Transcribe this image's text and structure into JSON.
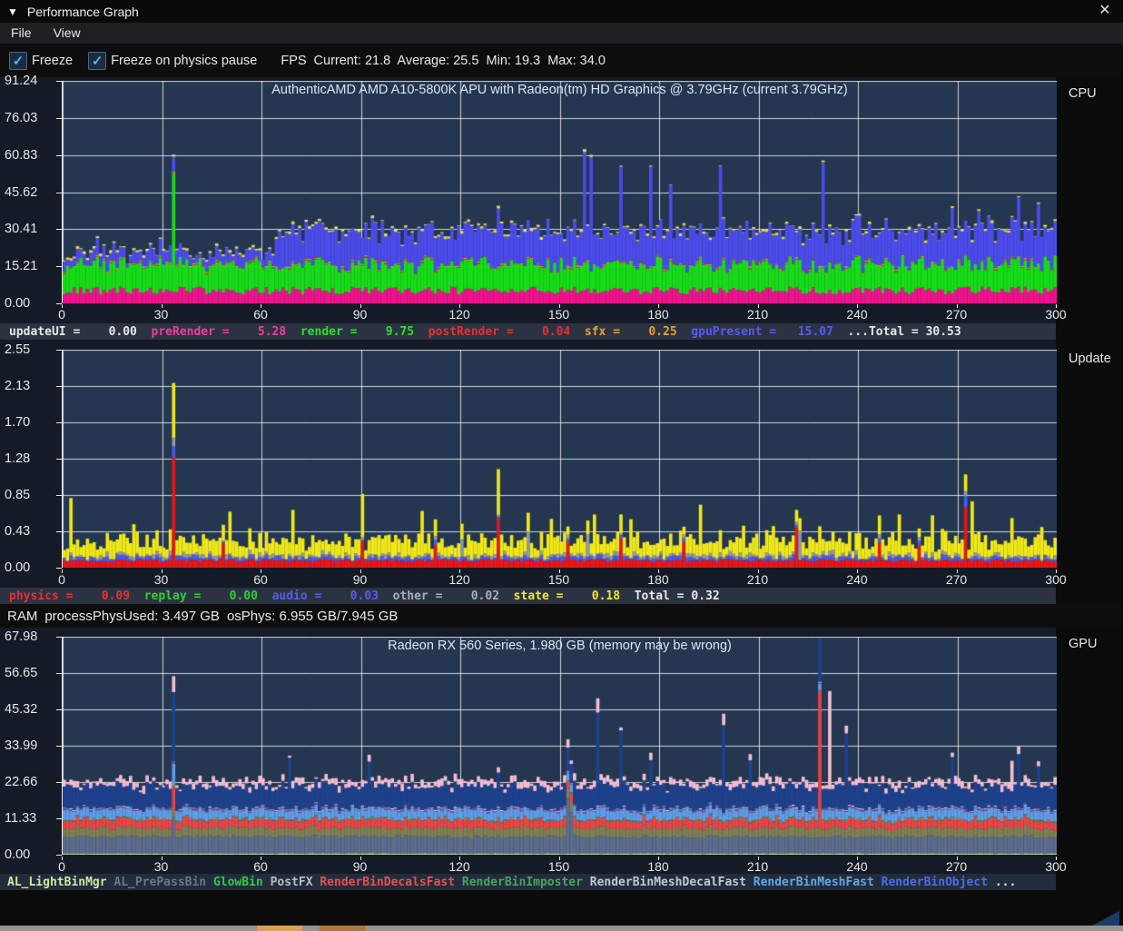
{
  "window": {
    "title": "Performance Graph",
    "icon": "▼",
    "close_icon": "✕"
  },
  "menu": {
    "items": [
      {
        "label": "File"
      },
      {
        "label": "View"
      }
    ]
  },
  "toolbar": {
    "check_glyph": "✓",
    "freeze": {
      "label": "Freeze",
      "checked": true
    },
    "freeze_physics": {
      "label": "Freeze on physics pause",
      "checked": true
    },
    "fps": {
      "label": "FPS",
      "stats": "Current: 21.8  Average: 25.5  Min: 19.3  Max: 34.0"
    }
  },
  "ram_bar": {
    "label": "RAM",
    "process": "processPhysUsed: 3.497 GB",
    "os": "osPhys: 6.955 GB/7.945 GB"
  },
  "chart_data": [
    {
      "id": "cpu",
      "type": "stacked-bar",
      "right_label": "CPU",
      "seed": 7,
      "title": "AuthenticAMD AMD A10-5800K APU with Radeon(tm) HD Graphics   @ 3.79GHz (current 3.79GHz)",
      "ymax": 91.24,
      "y_ticks": [
        "91.24",
        "76.03",
        "60.83",
        "45.62",
        "30.41",
        "15.21",
        "0.00"
      ],
      "x_range": [
        0,
        300
      ],
      "x_ticks": [
        0,
        30,
        60,
        90,
        120,
        150,
        180,
        210,
        240,
        270,
        300
      ],
      "n_points": 300,
      "plot_bg": "#243650",
      "grid": true,
      "series": [
        {
          "name": "preRender",
          "color": "#f0128c",
          "base": 5.3,
          "var": 1.6
        },
        {
          "name": "render",
          "color": "#16dd16",
          "base": 10.5,
          "var": 2.6
        },
        {
          "name": "postRender",
          "color": "#e03030",
          "base": 0.18,
          "var": 0.35
        },
        {
          "name": "sfx",
          "color": "#e09020",
          "base": 0.28,
          "var": 0.4
        },
        {
          "name": "gpuPresent",
          "color": "#4b4beb",
          "base": 13.2,
          "var": 3.2,
          "profile": [
            {
              "from": 0,
              "to": 63,
              "base": 4.2,
              "var": 2.8
            },
            {
              "from": 64,
              "to": 300,
              "base": 13.2,
              "var": 3.2
            }
          ]
        },
        {
          "name": "yellowCap",
          "color": "#f0e030",
          "base": 0.45,
          "var": 0.55
        },
        {
          "name": "updateUI_dots",
          "color": "#f0f0f0",
          "base": 0.08,
          "var": 0.3
        }
      ],
      "spikes": [
        {
          "x": 33,
          "series": "render",
          "add": 38
        },
        {
          "x": 131,
          "series": "gpuPresent",
          "add": 12
        },
        {
          "x": 157,
          "series": "gpuPresent",
          "add": 30
        },
        {
          "x": 159,
          "series": "gpuPresent",
          "add": 33
        },
        {
          "x": 168,
          "series": "gpuPresent",
          "add": 28
        },
        {
          "x": 177,
          "series": "gpuPresent",
          "add": 26
        },
        {
          "x": 183,
          "series": "gpuPresent",
          "add": 18
        },
        {
          "x": 198,
          "series": "gpuPresent",
          "add": 28
        },
        {
          "x": 229,
          "series": "gpuPresent",
          "add": 31
        },
        {
          "x": 268,
          "series": "gpuPresent",
          "add": 12
        },
        {
          "x": 276,
          "series": "gpuPresent",
          "add": 10
        },
        {
          "x": 288,
          "series": "gpuPresent",
          "add": 11
        },
        {
          "x": 294,
          "series": "gpuPresent",
          "add": 9
        }
      ],
      "legend": {
        "bg": "#2b3342",
        "items": [
          {
            "label": "updateUI",
            "value": "0.00",
            "color": "#e8e8e8",
            "pad": true
          },
          {
            "label": "preRender",
            "value": "5.28",
            "color": "#f03ca0",
            "pad": true
          },
          {
            "label": "render",
            "value": "9.75",
            "color": "#30e030",
            "pad": true
          },
          {
            "label": "postRender",
            "value": "0.04",
            "color": "#e83030",
            "pad": true
          },
          {
            "label": "sfx",
            "value": "0.25",
            "color": "#e8a030",
            "pad": true
          },
          {
            "label": "gpuPresent",
            "value": "15.07",
            "color": "#5858f0",
            "pad": true
          },
          {
            "label": "...Total",
            "value": "30.53",
            "color": "#e8e8e8",
            "pad": false
          }
        ]
      }
    },
    {
      "id": "update",
      "type": "stacked-bar",
      "right_label": "Update",
      "seed": 13,
      "title": "",
      "ymax": 2.55,
      "y_ticks": [
        "2.55",
        "2.13",
        "1.70",
        "1.28",
        "0.85",
        "0.43",
        "0.00"
      ],
      "x_range": [
        0,
        300
      ],
      "x_ticks": [
        0,
        30,
        60,
        90,
        120,
        150,
        180,
        210,
        240,
        270,
        300
      ],
      "n_points": 300,
      "plot_bg": "#243650",
      "grid": true,
      "series": [
        {
          "name": "physics",
          "color": "#e81616",
          "base": 0.085,
          "var": 0.02
        },
        {
          "name": "audio",
          "color": "#4b5ae8",
          "base": 0.035,
          "var": 0.025
        },
        {
          "name": "other",
          "color": "#9098a8",
          "base": 0.028,
          "var": 0.03
        },
        {
          "name": "state",
          "color": "#f0e818",
          "base": 0.17,
          "var": 0.09
        }
      ],
      "spikes": [
        {
          "x": 33,
          "series": "physics",
          "add": 1.2
        },
        {
          "x": 33,
          "series": "audio",
          "add": 0.08
        },
        {
          "x": 33,
          "series": "other",
          "add": 0.1
        },
        {
          "x": 33,
          "series": "state",
          "add": 0.52
        },
        {
          "x": 131,
          "series": "physics",
          "add": 0.48
        },
        {
          "x": 131,
          "series": "state",
          "add": 0.3
        },
        {
          "x": 221,
          "series": "physics",
          "add": 0.38
        },
        {
          "x": 272,
          "series": "physics",
          "add": 0.62
        },
        {
          "x": 272,
          "series": "audio",
          "add": 0.1
        },
        {
          "x": 48,
          "series": "physics",
          "add": 0.2
        },
        {
          "x": 90,
          "series": "physics",
          "add": 0.22
        },
        {
          "x": 112,
          "series": "physics",
          "add": 0.18
        },
        {
          "x": 152,
          "series": "physics",
          "add": 0.22
        },
        {
          "x": 168,
          "series": "physics",
          "add": 0.25
        },
        {
          "x": 187,
          "series": "physics",
          "add": 0.2
        },
        {
          "x": 246,
          "series": "physics",
          "add": 0.22
        },
        {
          "x": 258,
          "series": "physics",
          "add": 0.18
        },
        {
          "x": 120,
          "series": "other",
          "add": 0.15
        },
        {
          "x": 140,
          "series": "other",
          "add": 0.28
        },
        {
          "x": 158,
          "series": "other",
          "add": 0.22
        },
        {
          "x": 222,
          "series": "other",
          "add": 0.33
        },
        {
          "x": 2,
          "series": "state",
          "add": 0.42
        },
        {
          "x": 21,
          "series": "state",
          "add": 0.28
        },
        {
          "x": 50,
          "series": "state",
          "add": 0.25
        },
        {
          "x": 69,
          "series": "state",
          "add": 0.32
        },
        {
          "x": 90,
          "series": "state",
          "add": 0.25
        },
        {
          "x": 108,
          "series": "state",
          "add": 0.3
        },
        {
          "x": 147,
          "series": "state",
          "add": 0.33
        },
        {
          "x": 160,
          "series": "state",
          "add": 0.28
        },
        {
          "x": 171,
          "series": "state",
          "add": 0.25
        },
        {
          "x": 192,
          "series": "state",
          "add": 0.38
        },
        {
          "x": 205,
          "series": "state",
          "add": 0.22
        },
        {
          "x": 214,
          "series": "state",
          "add": 0.25
        },
        {
          "x": 228,
          "series": "state",
          "add": 0.2
        },
        {
          "x": 240,
          "series": "state",
          "add": 0.22
        },
        {
          "x": 252,
          "series": "state",
          "add": 0.25
        },
        {
          "x": 262,
          "series": "state",
          "add": 0.2
        },
        {
          "x": 274,
          "series": "state",
          "add": 0.42
        },
        {
          "x": 286,
          "series": "state",
          "add": 0.3
        },
        {
          "x": 295,
          "series": "state",
          "add": 0.22
        }
      ],
      "legend": {
        "bg": "#2b3342",
        "items": [
          {
            "label": "physics",
            "value": "0.09",
            "color": "#e83030",
            "pad": true
          },
          {
            "label": "replay",
            "value": "0.00",
            "color": "#30d030",
            "pad": true
          },
          {
            "label": "audio",
            "value": "0.03",
            "color": "#5560e8",
            "pad": true
          },
          {
            "label": "other",
            "value": "0.02",
            "color": "#a8aeb8",
            "pad": true
          },
          {
            "label": "state",
            "value": "0.18",
            "color": "#f0e830",
            "pad": true
          },
          {
            "label": "Total",
            "value": "0.32",
            "color": "#e8e8e8",
            "pad": false
          }
        ]
      }
    },
    {
      "id": "gpu",
      "type": "stacked-bar",
      "right_label": "GPU",
      "seed": 21,
      "title": "Radeon RX 560 Series, 1.980 GB (memory may be wrong)",
      "ymax": 67.98,
      "y_ticks": [
        "67.98",
        "56.65",
        "45.32",
        "33.99",
        "22.66",
        "11.33",
        "0.00"
      ],
      "x_range": [
        0,
        300
      ],
      "x_ticks": [
        0,
        30,
        60,
        90,
        120,
        150,
        180,
        210,
        240,
        270,
        300
      ],
      "n_points": 300,
      "plot_bg": "#243650",
      "grid": true,
      "series": [
        {
          "name": "AL_LightBinMgr",
          "color": "#c6e296",
          "base": 0.35,
          "var": 0.12
        },
        {
          "name": "AL_PrePassBin",
          "color": "#5c6c8a",
          "base": 5.3,
          "var": 0.5
        },
        {
          "name": "PostFX",
          "color": "#7e7e52",
          "base": 2.7,
          "var": 0.5
        },
        {
          "name": "RenderBinDecalsFast",
          "color": "#e84545",
          "base": 2.6,
          "var": 0.6
        },
        {
          "name": "RenderBinImposter",
          "color": "#2f9e50",
          "base": 0.3,
          "var": 0.2
        },
        {
          "name": "RenderBinMeshFast",
          "color": "#5e9ce8",
          "base": 2.7,
          "var": 0.5
        },
        {
          "name": "purpleSliver",
          "color": "#8a3c92",
          "base": 0.35,
          "var": 0.25
        },
        {
          "name": "whiteSliver",
          "color": "#e8e8f0",
          "base": 0.22,
          "var": 0.12
        },
        {
          "name": "RenderBinObject",
          "color": "#1d418c",
          "base": 6.8,
          "var": 1.3
        },
        {
          "name": "RenderBinMeshDecalFast",
          "color": "#f5bdd2",
          "base": 1.5,
          "var": 1.1
        }
      ],
      "spikes": [
        {
          "x": 33,
          "series": "AL_PrePassBin",
          "add": 6
        },
        {
          "x": 33,
          "series": "RenderBinDecalsFast",
          "add": 5
        },
        {
          "x": 33,
          "series": "RenderBinMeshFast",
          "add": 4
        },
        {
          "x": 33,
          "series": "RenderBinObject",
          "add": 14
        },
        {
          "x": 33,
          "series": "RenderBinMeshDecalFast",
          "add": 4
        },
        {
          "x": 152,
          "series": "AL_PrePassBin",
          "add": 12
        },
        {
          "x": 153,
          "series": "AL_PrePassBin",
          "add": 8
        },
        {
          "x": 68,
          "series": "RenderBinObject",
          "add": 9
        },
        {
          "x": 92,
          "series": "RenderBinObject",
          "add": 8
        },
        {
          "x": 131,
          "series": "RenderBinObject",
          "add": 5
        },
        {
          "x": 161,
          "series": "RenderBinObject",
          "add": 21
        },
        {
          "x": 161,
          "series": "RenderBinMeshDecalFast",
          "add": 3
        },
        {
          "x": 168,
          "series": "RenderBinObject",
          "add": 19
        },
        {
          "x": 177,
          "series": "RenderBinObject",
          "add": 9
        },
        {
          "x": 199,
          "series": "RenderBinObject",
          "add": 20
        },
        {
          "x": 199,
          "series": "RenderBinMeshDecalFast",
          "add": 3
        },
        {
          "x": 207,
          "series": "RenderBinObject",
          "add": 8
        },
        {
          "x": 228,
          "series": "RenderBinDecalsFast",
          "add": 40
        },
        {
          "x": 228,
          "series": "RenderBinObject",
          "add": 6
        },
        {
          "x": 228,
          "series": "RenderBinMeshDecalFast",
          "add": 6
        },
        {
          "x": 231,
          "series": "RenderBinMeshDecalFast",
          "add": 30
        },
        {
          "x": 236,
          "series": "RenderBinObject",
          "add": 17
        },
        {
          "x": 268,
          "series": "RenderBinObject",
          "add": 7
        },
        {
          "x": 286,
          "series": "RenderBinMeshDecalFast",
          "add": 8
        },
        {
          "x": 288,
          "series": "RenderBinObject",
          "add": 10
        },
        {
          "x": 294,
          "series": "RenderBinObject",
          "add": 7
        }
      ],
      "legend": {
        "bg": "#222c3c",
        "items": [
          {
            "label": "AL_LightBinMgr",
            "color": "#d4e69e"
          },
          {
            "label": "AL_PrePassBin",
            "color": "#6b7688"
          },
          {
            "label": "GlowBin",
            "color": "#2ecc40"
          },
          {
            "label": "PostFX",
            "color": "#b8bcc4"
          },
          {
            "label": "RenderBinDecalsFast",
            "color": "#e85050"
          },
          {
            "label": "RenderBinImposter",
            "color": "#4aa45e"
          },
          {
            "label": "RenderBinMeshDecalFast",
            "color": "#c2c8d2"
          },
          {
            "label": "RenderBinMeshFast",
            "color": "#62a8e8"
          },
          {
            "label": "RenderBinObject",
            "color": "#4b6de8"
          },
          {
            "label": "...",
            "color": "#e8e8e8"
          }
        ]
      }
    }
  ]
}
